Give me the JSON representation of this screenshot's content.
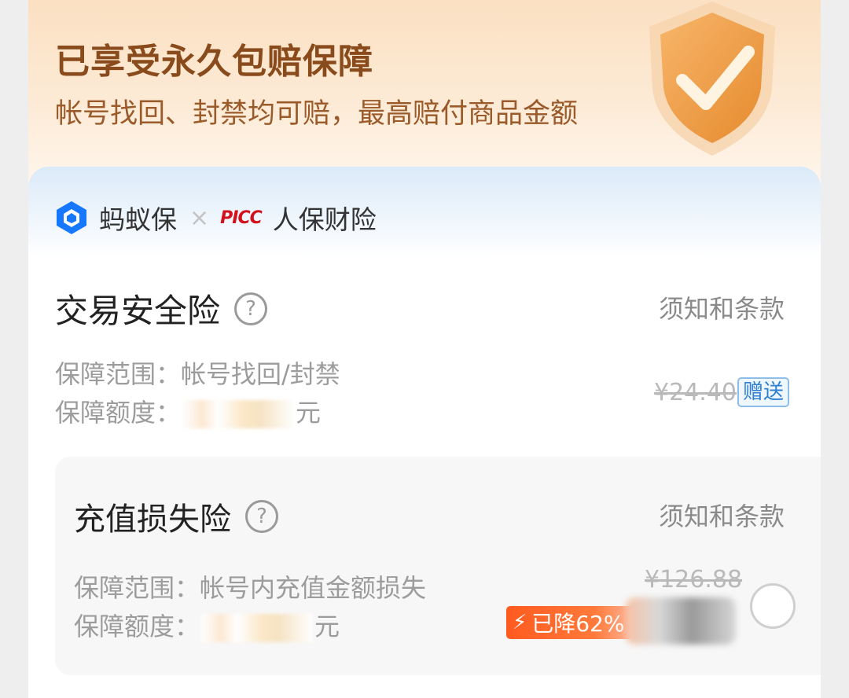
{
  "banner": {
    "title": "已享受永久包赔保障",
    "subtitle": "帐号找回、封禁均可赔，最高赔付商品金额"
  },
  "brand": {
    "ant_name": "蚂蚁保",
    "separator": "×",
    "picc_logo": "PICC",
    "picc_name": "人保财险"
  },
  "insurance_1": {
    "title": "交易安全险",
    "help": "?",
    "terms": "须知和条款",
    "scope": "保障范围：帐号找回/封禁",
    "amount_prefix": "保障额度：",
    "amount_suffix": "元",
    "old_price": "¥24.40",
    "tag": "赠送"
  },
  "insurance_2": {
    "title": "充值损失险",
    "help": "?",
    "terms": "须知和条款",
    "scope": "保障范围：帐号内充值金额损失",
    "amount_prefix": "保障额度：",
    "amount_suffix": "元",
    "old_price": "¥126.88",
    "discount": "已降62%",
    "selected": false
  },
  "colors": {
    "banner_title": "#8a4b1c",
    "discount_badge": "#ff5a1f",
    "gift_tag": "#2f7fd0",
    "picc_red": "#d3111c",
    "ant_blue": "#1677ff"
  }
}
